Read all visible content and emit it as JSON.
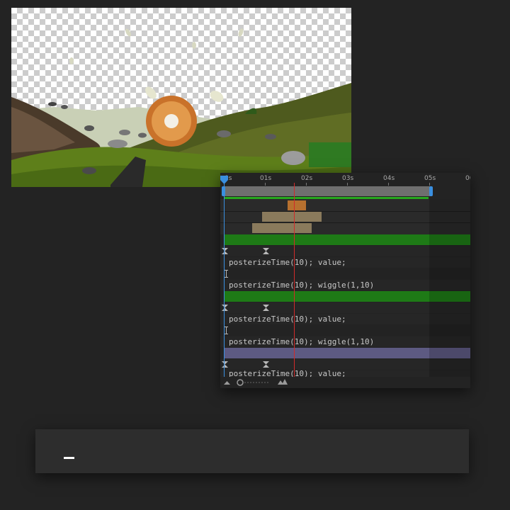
{
  "timeline": {
    "ruler_labels": [
      "0s",
      "01s",
      "02s",
      "03s",
      "04s",
      "05s",
      "06"
    ],
    "expressions": [
      "posterizeTime(10); value;",
      "posterizeTime(10); wiggle(1,10)",
      "posterizeTime(10); value;",
      "posterizeTime(10); wiggle(1,10)",
      "posterizeTime(10); value;"
    ]
  },
  "caption": {
    "text": ""
  },
  "colors": {
    "green_layer": "#1e7a16",
    "purple_layer": "#5d5a82",
    "playhead": "#d12a2a",
    "cti": "#3a8fe0",
    "orange_clip": "#b6702f",
    "tan_clip": "#8a7a5c"
  }
}
